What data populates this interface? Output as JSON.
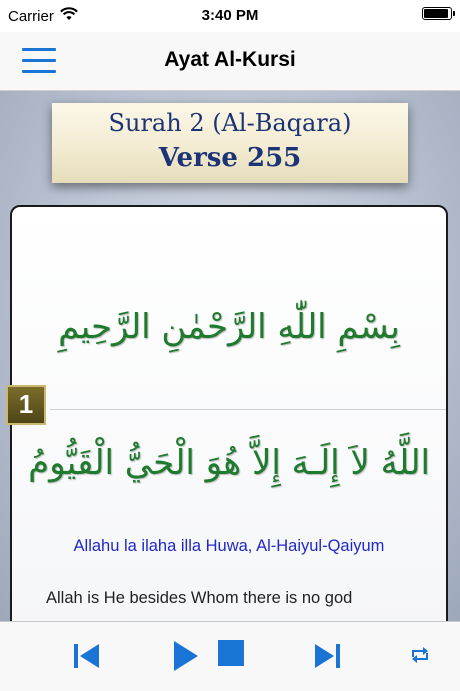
{
  "status_bar": {
    "carrier": "Carrier",
    "time": "3:40 PM",
    "battery_level": 1.0
  },
  "nav": {
    "title": "Ayat Al-Kursi",
    "menu_icon": "hamburger-menu-icon"
  },
  "banner": {
    "surah": "Surah 2 (Al-Baqara)",
    "verse": "Verse 255"
  },
  "verse": {
    "bismillah": "بِسْمِ اللّٰهِ الرَّحْمٰنِ الرَّحِيمِ",
    "number": "1",
    "arabic": "اللَّهُ لاَ إِلَـهَ إِلاَّ هُوَ الْحَيُّ الْقَيُّومُ",
    "transliteration": "Allahu la ilaha illa Huwa, Al-Haiyul-Qaiyum",
    "translation": "Allah is He besides Whom there is no god"
  },
  "toolbar": {
    "icons": [
      "skip-previous-icon",
      "play-icon",
      "stop-icon",
      "skip-next-icon",
      "repeat-icon"
    ],
    "accent_color": "#1a74d6"
  }
}
